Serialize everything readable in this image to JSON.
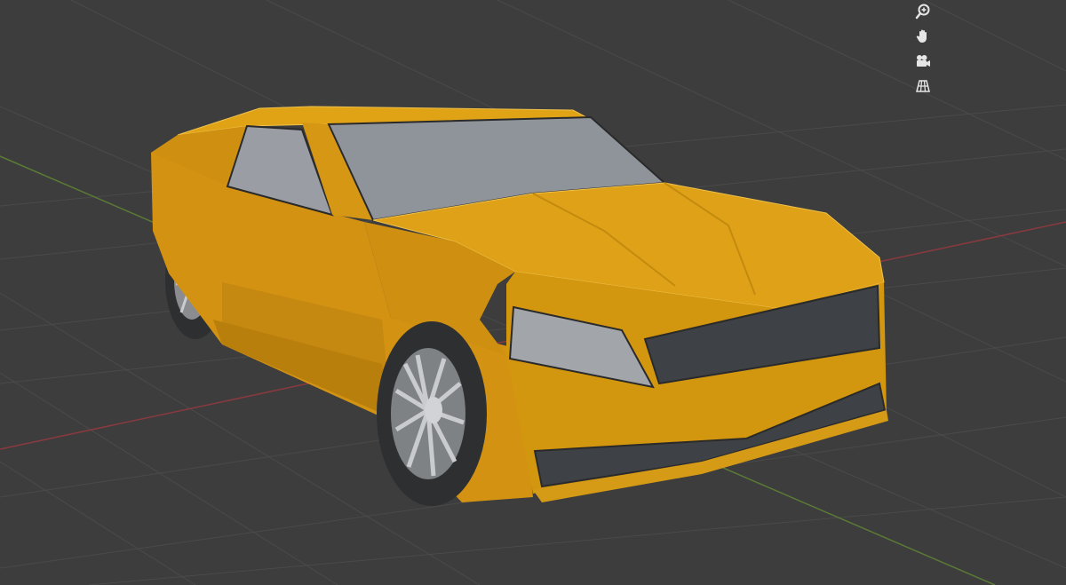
{
  "viewport": {
    "background": "#3d3d3d",
    "grid_color": "#4a4a4a",
    "x_axis_color": "#8a3a3e",
    "y_axis_color": "#5a7a36"
  },
  "object": {
    "body_color": "#d89a12",
    "glass_color": "#8f949a",
    "tire_color": "#2d2f31",
    "rim_color": "#9a9c9f",
    "grille_color": "#3e4145"
  },
  "nav_gizmo": {
    "buttons": [
      {
        "name": "zoom",
        "icon": "magnifier-plus-icon"
      },
      {
        "name": "pan",
        "icon": "hand-icon"
      },
      {
        "name": "camera",
        "icon": "camera-icon"
      },
      {
        "name": "perspective",
        "icon": "grid-perspective-icon"
      }
    ]
  }
}
